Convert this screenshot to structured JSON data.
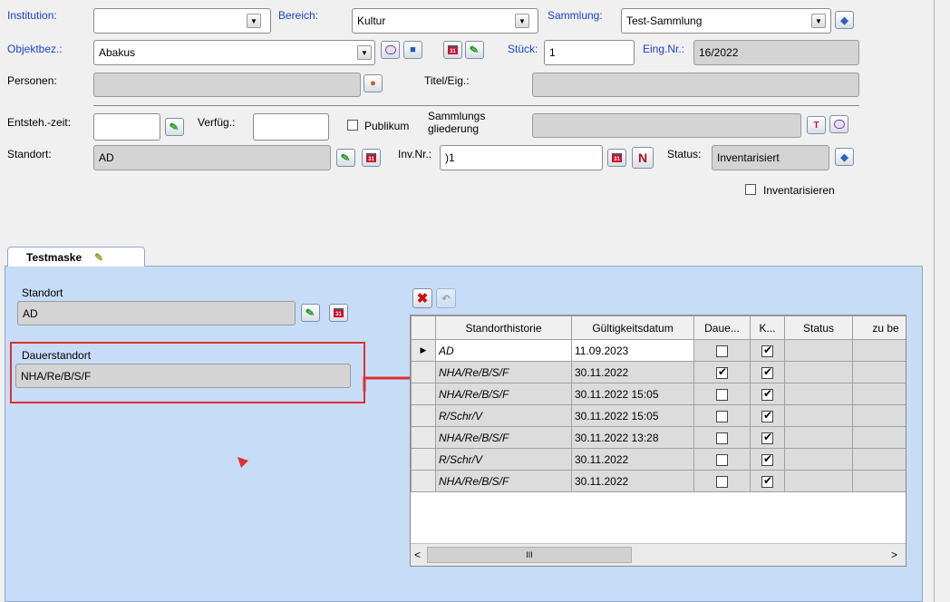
{
  "header": {
    "institution_label": "Institution:",
    "institution_value": "",
    "bereich_label": "Bereich:",
    "bereich_value": "Kultur",
    "sammlung_label": "Sammlung:",
    "sammlung_value": "Test-Sammlung",
    "objektbez_label": "Objektbez.:",
    "objektbez_value": "Abakus",
    "stueck_label": "Stück:",
    "stueck_value": "1",
    "eingnr_label": "Eing.Nr.:",
    "eingnr_value": "16/2022",
    "personen_label": "Personen:",
    "personen_value": "",
    "titel_label": "Titel/Eig.:",
    "titel_value": "",
    "entstehzeit_label": "Entsteh.-zeit:",
    "entstehzeit_value": "",
    "verfueg_label": "Verfüg.:",
    "verfueg_value": "",
    "publikum_label": "Publikum",
    "publikum_checked": false,
    "sammlungsgliederung_label_1": "Sammlungs",
    "sammlungsgliederung_label_2": "gliederung",
    "sammlungsgliederung_value": "",
    "standort_label": "Standort:",
    "standort_value": "AD",
    "invnr_label": "Inv.Nr.:",
    "invnr_value": ")1",
    "n_button": "N",
    "status_label": "Status:",
    "status_value": "Inventarisiert",
    "inventarisieren_label": "Inventarisieren",
    "inventarisieren_checked": false
  },
  "tab": {
    "label": "Testmaske"
  },
  "form": {
    "standort_label": "Standort",
    "standort_value": "AD",
    "dauerstandort_label": "Dauerstandort",
    "dauerstandort_value": "NHA/Re/B/S/F"
  },
  "grid": {
    "columns": [
      "Standorthistorie",
      "Gültigkeitsdatum",
      "Daue...",
      "K...",
      "Status",
      "zu be"
    ],
    "rows": [
      {
        "standort": "AD",
        "datum": "11.09.2023",
        "dauer": false,
        "k": true,
        "status": "",
        "zube": "",
        "current": true
      },
      {
        "standort": "NHA/Re/B/S/F",
        "datum": "30.11.2022",
        "dauer": true,
        "k": true,
        "status": "",
        "zube": "",
        "current": false
      },
      {
        "standort": "NHA/Re/B/S/F",
        "datum": "30.11.2022 15:05",
        "dauer": false,
        "k": true,
        "status": "",
        "zube": "",
        "current": false
      },
      {
        "standort": "R/Schr/V",
        "datum": "30.11.2022 15:05",
        "dauer": false,
        "k": true,
        "status": "",
        "zube": "",
        "current": false
      },
      {
        "standort": "NHA/Re/B/S/F",
        "datum": "30.11.2022 13:28",
        "dauer": false,
        "k": true,
        "status": "",
        "zube": "",
        "current": false
      },
      {
        "standort": "R/Schr/V",
        "datum": "30.11.2022",
        "dauer": false,
        "k": true,
        "status": "",
        "zube": "",
        "current": false
      },
      {
        "standort": "NHA/Re/B/S/F",
        "datum": "30.11.2022",
        "dauer": false,
        "k": true,
        "status": "",
        "zube": "",
        "current": false
      }
    ],
    "scroll_thumb_glyph": "III"
  },
  "icons": {
    "dropdown": "chevron-down-icon",
    "pencil": "pencil-icon",
    "calendar": "calendar-icon",
    "speech_bubble": "speech-bubble-icon",
    "delete": "delete-icon",
    "undo": "undo-icon",
    "person": "person-icon",
    "text_field": "text-field-icon"
  },
  "colors": {
    "label_blue": "#1f3fc8",
    "highlight_red": "#e03030",
    "panel_blue": "#c7dcf7",
    "readonly_gray": "#d4d4d4"
  }
}
